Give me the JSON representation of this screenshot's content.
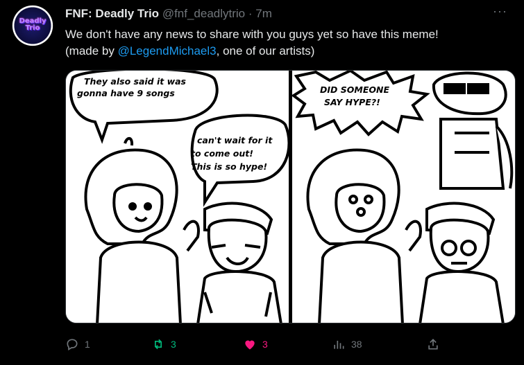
{
  "tweet": {
    "display_name": "FNF: Deadly Trio",
    "handle": "@fnf_deadlytrio",
    "separator": "·",
    "time": "7m",
    "text_line1": "We don't have any news to share with you guys yet so have this meme!",
    "text_prefix": "(made by ",
    "mention": "@LegendMichael3",
    "text_suffix": ", one of our artists)"
  },
  "avatar": {
    "logo_text": "Deadly Trio"
  },
  "media": {
    "panel1": {
      "bubble1_line1": "They also said it was",
      "bubble1_line2": "gonna have 9 songs",
      "bubble2_line1": "I can't wait for it",
      "bubble2_line2": "to come out!",
      "bubble2_line3": "This is so hype!"
    },
    "panel2": {
      "bubble_line1": "DID SOMEONE",
      "bubble_line2": "SAY HYPE?!"
    }
  },
  "actions": {
    "reply_count": "1",
    "retweet_count": "3",
    "like_count": "3",
    "views_count": "38"
  },
  "colors": {
    "background": "#000000",
    "text": "#e7e9ea",
    "muted": "#71767b",
    "link": "#1d9bf0",
    "retweet": "#00ba7c",
    "like": "#f91880"
  }
}
